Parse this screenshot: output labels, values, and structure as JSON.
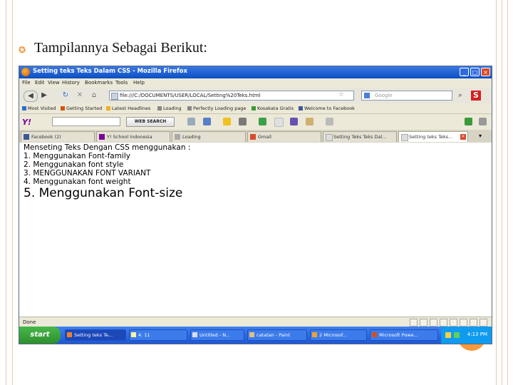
{
  "slide": {
    "title": "Tampilannya Sebagai Berikut:",
    "accent_color": "#f28c28",
    "bullet_icon": "circle-bullet-icon"
  },
  "browser": {
    "window_title": "Setting teks Teks Dalam CSS - Mozilla Firefox",
    "menu": [
      "File",
      "Edit",
      "View",
      "History",
      "Bookmarks",
      "Tools",
      "Help"
    ],
    "address": "file:///C:/DOCUMENTS/USER/LOCAL/Setting%20Teks.html",
    "search_placeholder": "Google",
    "bookmarks": [
      "Most Visited",
      "Getting Started",
      "Latest Headlines",
      "Loading",
      "Perfectly Loading page",
      "Kosakata Gratis",
      "Welcome to Facebook"
    ],
    "yahoo_logo": "Y!",
    "web_search_label": "WEB SEARCH",
    "tabs": [
      "Facebook (2)",
      "Y! School Indonesia",
      "Loading",
      "Gmail",
      "Setting Teks Teks Dal...",
      "Setting teks Teks..."
    ],
    "content_lines": [
      "Menseting Teks Dengan CSS menggunakan :",
      "1. Menggunakan Font-family",
      "2. Menggunakan font style",
      "3. MENGGUNAKAN FONT VARIANT",
      "4. Menggunakan font weight",
      "5. Menggunakan Font-size"
    ],
    "status": "Done"
  },
  "taskbar": {
    "start_label": "start",
    "tasks": [
      "Setting teks Te...",
      "4. 11",
      "Untitled - N...",
      "catatan - Paint",
      "2 Microsof...",
      "Microsoft Powe..."
    ],
    "clock": "4:13 PM"
  }
}
